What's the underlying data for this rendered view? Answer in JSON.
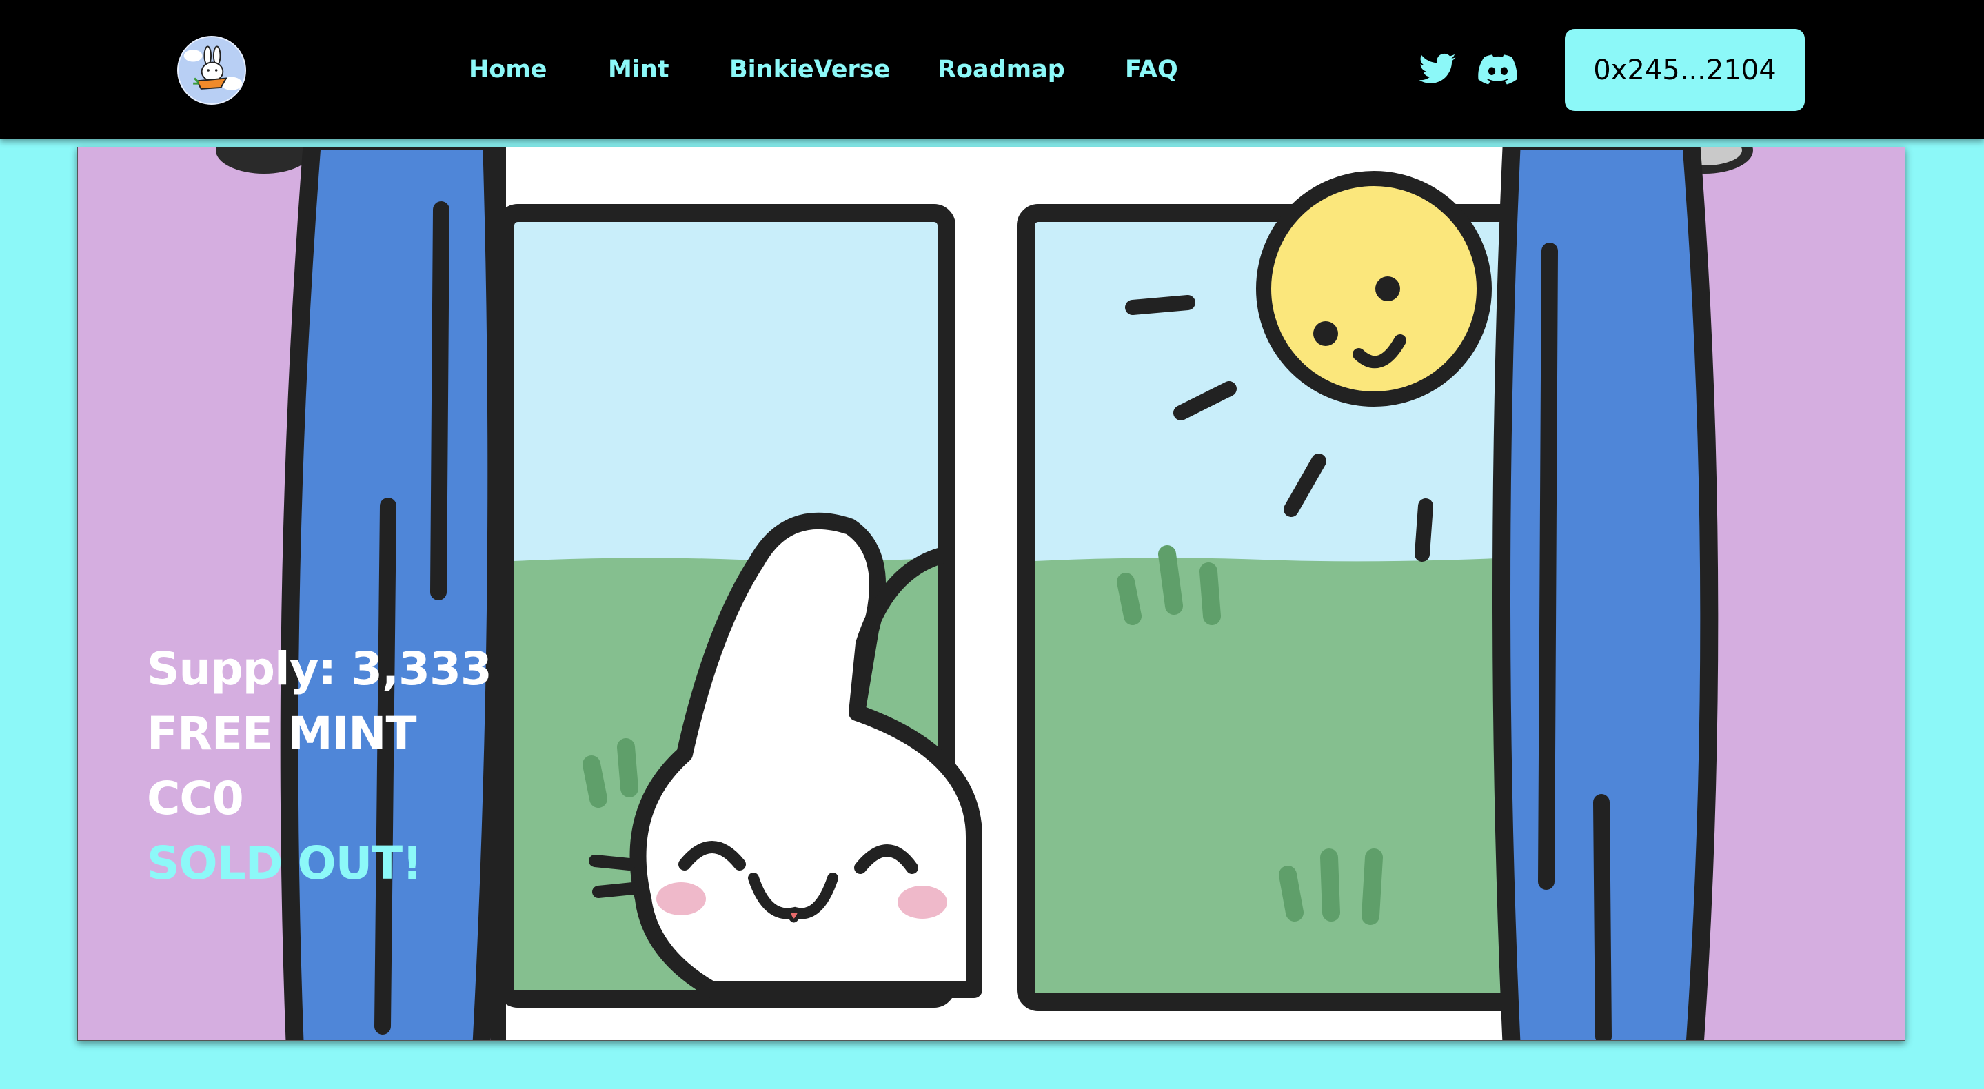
{
  "header": {
    "logo_icon": "bunny-carrot-logo-icon",
    "nav": [
      {
        "label": "Home"
      },
      {
        "label": "Mint"
      },
      {
        "label": "BinkieVerse"
      },
      {
        "label": "Roadmap"
      },
      {
        "label": "FAQ"
      }
    ],
    "social": [
      {
        "icon": "twitter-icon"
      },
      {
        "icon": "discord-icon"
      }
    ],
    "wallet_label": "0x245...2104"
  },
  "hero": {
    "scene": "bunny-peeking-through-window-illustration",
    "lines": {
      "supply": "Supply: 3,333",
      "free_mint": "FREE MINT",
      "license": "CC0",
      "status": "SOLD OUT!"
    }
  },
  "colors": {
    "accent": "#8cf8f8",
    "header_bg": "#000000",
    "wall": "#d5aee0",
    "curtain": "#4f86d8",
    "sky": "#c9eefa",
    "grass": "#85bf8f",
    "sun": "#fbe77c"
  }
}
